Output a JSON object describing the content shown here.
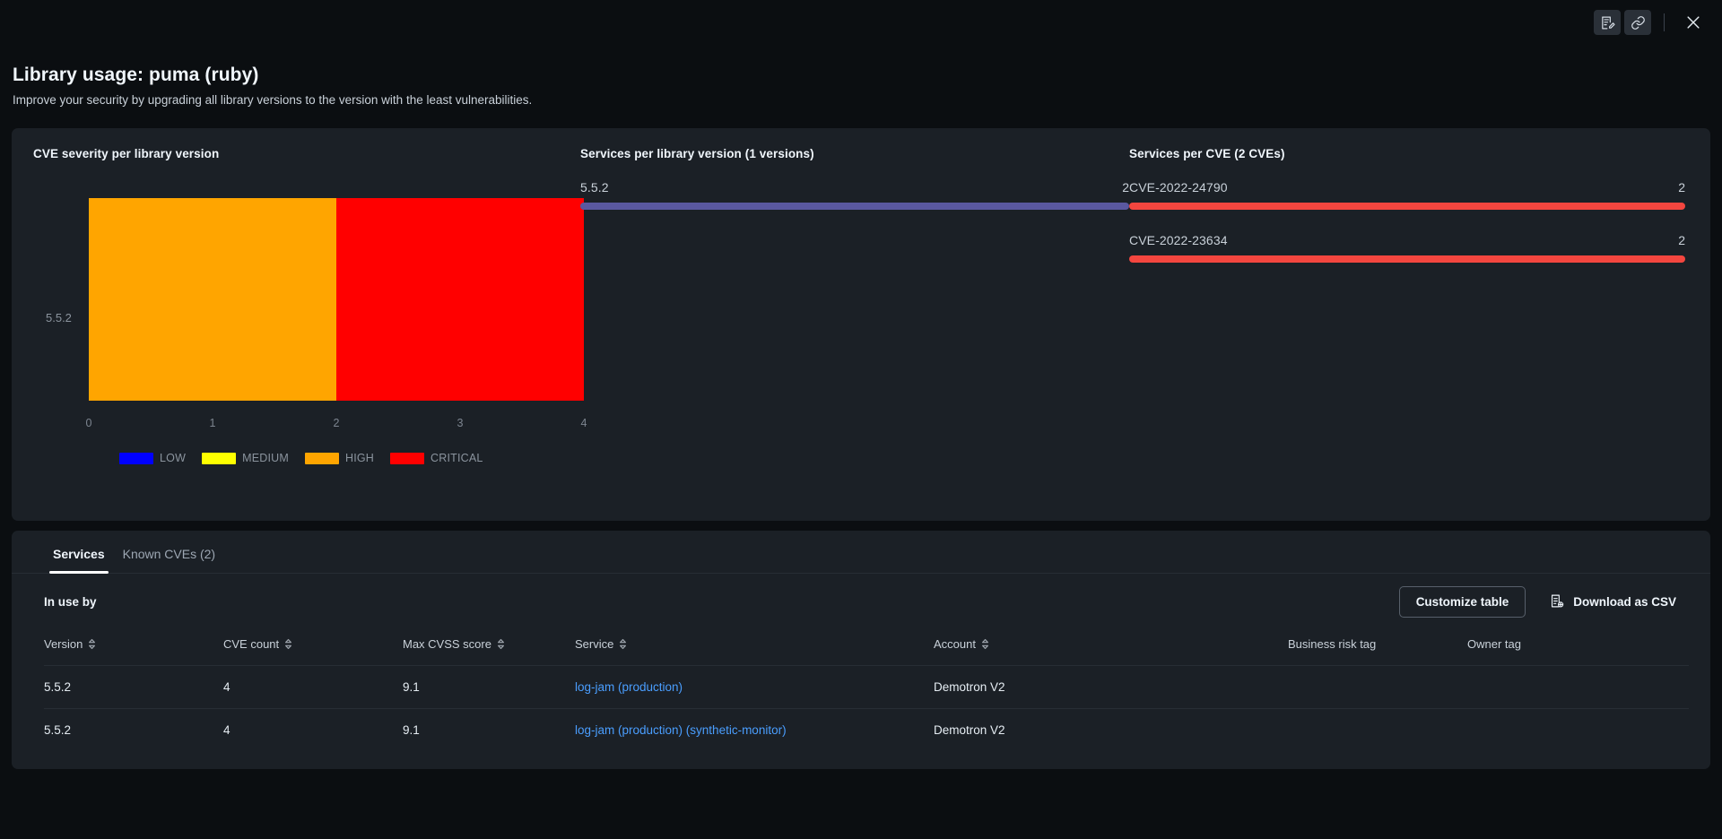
{
  "topbar": {
    "edit_note_icon": "note-edit-icon",
    "link_icon": "link-icon",
    "close_icon": "close-icon"
  },
  "header": {
    "title": "Library usage: puma (ruby)",
    "subtitle": "Improve your security by upgrading all library versions to the version with the least vulnerabilities."
  },
  "charts": {
    "severity": {
      "title": "CVE severity per library version"
    },
    "services_per_version": {
      "title": "Services per library version (1 versions)"
    },
    "services_per_cve": {
      "title": "Services per CVE (2 CVEs)"
    }
  },
  "chart_data": [
    {
      "type": "bar",
      "orientation": "horizontal",
      "stacked": true,
      "title": "CVE severity per library version",
      "categories": [
        "5.5.2"
      ],
      "series": [
        {
          "name": "LOW",
          "color": "#0000ff",
          "values": [
            0
          ]
        },
        {
          "name": "MEDIUM",
          "color": "#ffff00",
          "values": [
            0
          ]
        },
        {
          "name": "HIGH",
          "color": "#ffa500",
          "values": [
            2
          ]
        },
        {
          "name": "CRITICAL",
          "color": "#ff0000",
          "values": [
            2
          ]
        }
      ],
      "xlabel": "",
      "ylabel": "",
      "xlim": [
        0,
        4
      ],
      "xticks": [
        "0",
        "1",
        "2",
        "3",
        "4"
      ],
      "grid": false,
      "legend": {
        "position": "bottom",
        "entries": [
          {
            "label": "LOW",
            "color": "#0000ff"
          },
          {
            "label": "MEDIUM",
            "color": "#ffff00"
          },
          {
            "label": "HIGH",
            "color": "#ffa500"
          },
          {
            "label": "CRITICAL",
            "color": "#ff0000"
          }
        ]
      }
    },
    {
      "type": "bar",
      "orientation": "horizontal",
      "title": "Services per library version (1 versions)",
      "categories": [
        "5.5.2"
      ],
      "values": [
        2
      ],
      "max": 2,
      "color": "#5a58a0",
      "value_labels": [
        "2"
      ],
      "xlabel": "",
      "ylabel": "",
      "grid": false
    },
    {
      "type": "bar",
      "orientation": "horizontal",
      "title": "Services per CVE (2 CVEs)",
      "categories": [
        "CVE-2022-24790",
        "CVE-2022-23634"
      ],
      "values": [
        2,
        2
      ],
      "max": 2,
      "color": "#f4463f",
      "value_labels": [
        "2",
        "2"
      ],
      "xlabel": "",
      "ylabel": "",
      "grid": false
    }
  ],
  "tabs": [
    {
      "label": "Services",
      "active": true
    },
    {
      "label": "Known CVEs (2)",
      "active": false
    }
  ],
  "table_toolbar": {
    "in_use_by": "In use by",
    "customize_table": "Customize table",
    "download_csv": "Download as CSV",
    "download_icon": "document-add-icon"
  },
  "table": {
    "columns": [
      {
        "label": "Version",
        "sortable": true
      },
      {
        "label": "CVE count",
        "sortable": true
      },
      {
        "label": "Max CVSS score",
        "sortable": true
      },
      {
        "label": "Service",
        "sortable": true
      },
      {
        "label": "Account",
        "sortable": true
      },
      {
        "label": "Business risk tag",
        "sortable": false
      },
      {
        "label": "Owner tag",
        "sortable": false
      }
    ],
    "rows": [
      {
        "version": "5.5.2",
        "cve_count": "4",
        "max_cvss": "9.1",
        "service": "log-jam (production)",
        "account": "Demotron V2",
        "business_risk_tag": "",
        "owner_tag": ""
      },
      {
        "version": "5.5.2",
        "cve_count": "4",
        "max_cvss": "9.1",
        "service": "log-jam (production) (synthetic-monitor)",
        "account": "Demotron V2",
        "business_risk_tag": "",
        "owner_tag": ""
      }
    ]
  },
  "colors": {
    "page_bg": "#0b0e11",
    "panel_bg": "#1b2026",
    "link": "#4a9eff",
    "low": "#0000ff",
    "medium": "#ffff00",
    "high": "#ffa500",
    "critical": "#ff0000",
    "version_bar": "#5a58a0",
    "cve_bar": "#f4463f"
  }
}
